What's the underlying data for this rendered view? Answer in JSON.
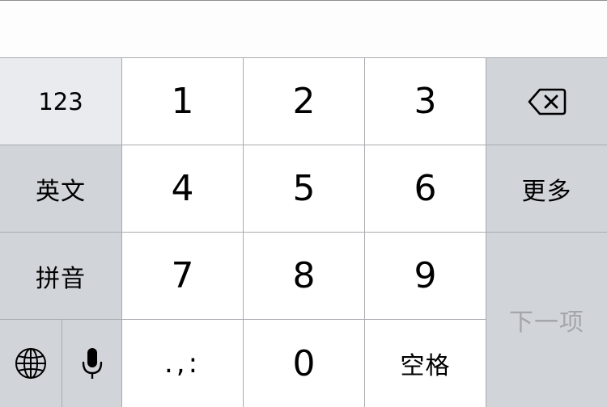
{
  "keyboard": {
    "row1": {
      "mode_123": "123",
      "digits": [
        "1",
        "2",
        "3"
      ],
      "delete_icon": "backspace-icon"
    },
    "row2": {
      "mode_english": "英文",
      "digits": [
        "4",
        "5",
        "6"
      ],
      "more": "更多"
    },
    "row3": {
      "mode_pinyin": "拼音",
      "digits": [
        "7",
        "8",
        "9"
      ]
    },
    "row4": {
      "globe_icon": "globe-icon",
      "mic_icon": "microphone-icon",
      "punctuation": ".,:",
      "zero": "0",
      "space": "空格"
    },
    "next": "下一项"
  },
  "colors": {
    "key_white": "#ffffff",
    "key_gray": "#d1d4d9",
    "key_123": "#e9ebee",
    "divider": "#a9abb0",
    "disabled_text": "#a4a6aa"
  }
}
